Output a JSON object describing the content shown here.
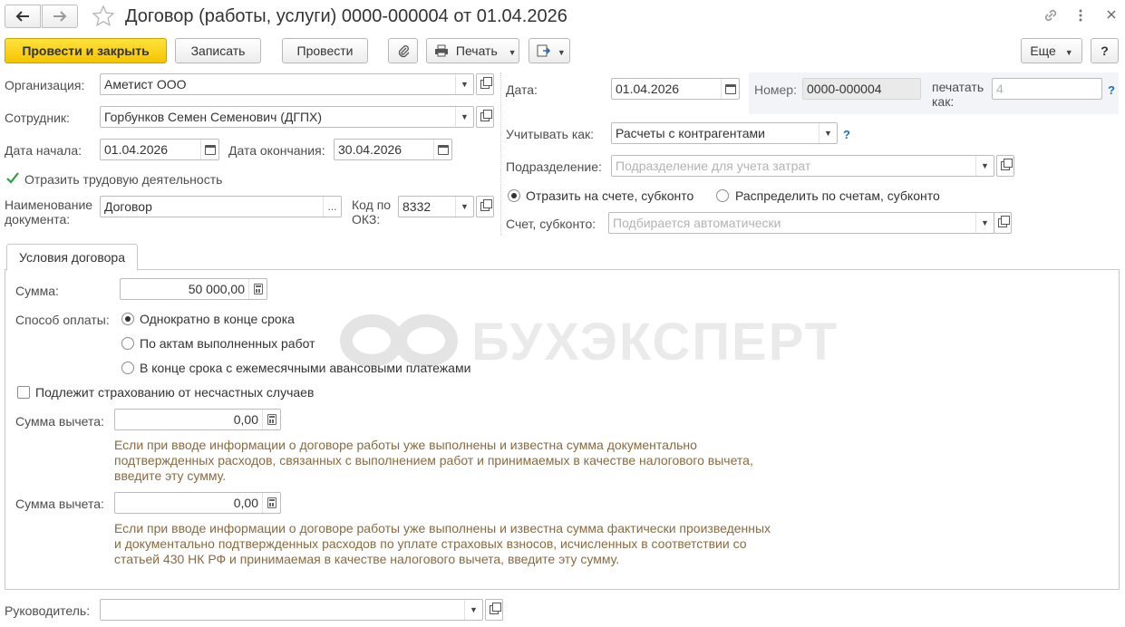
{
  "window": {
    "title": "Договор (работы, услуги) 0000-000004 от 01.04.2026"
  },
  "toolbar": {
    "post_close": "Провести и закрыть",
    "save": "Записать",
    "post": "Провести",
    "print": "Печать",
    "more": "Еще",
    "help": "?"
  },
  "left": {
    "org_label": "Организация:",
    "org_value": "Аметист ООО",
    "employee_label": "Сотрудник:",
    "employee_value": "Горбунков Семен Семенович (ДГПХ)",
    "start_label": "Дата начала:",
    "start_value": "01.04.2026",
    "end_label": "Дата окончания:",
    "end_value": "30.04.2026",
    "labor_check_label": "Отразить трудовую деятельность",
    "docname_label_1": "Наименование",
    "docname_label_2": "документа:",
    "docname_value": "Договор",
    "okz_label_1": "Код по",
    "okz_label_2": "ОКЗ:",
    "okz_value": "8332"
  },
  "right": {
    "date_label": "Дата:",
    "date_value": "01.04.2026",
    "number_label": "Номер:",
    "number_value": "0000-000004",
    "print_as_label_1": "печатать",
    "print_as_label_2": "как:",
    "print_as_placeholder": "4",
    "account_as_label": "Учитывать как:",
    "account_as_value": "Расчеты с контрагентами",
    "dept_label": "Подразделение:",
    "dept_placeholder": "Подразделение для учета затрат",
    "radio_account": "Отразить на счете, субконто",
    "radio_distribute": "Распределить по счетам, субконто",
    "subconto_label": "Счет, субконто:",
    "subconto_placeholder": "Подбирается автоматически",
    "help_mark": "?"
  },
  "tab": {
    "label": "Условия договора",
    "sum_label": "Сумма:",
    "sum_value": "50 000,00",
    "payment_label": "Способ оплаты:",
    "payment_options": [
      "Однократно в конце срока",
      "По актам выполненных работ",
      "В конце срока с ежемесячными авансовыми платежами"
    ],
    "insurance_label": "Подлежит страхованию от несчастных случаев",
    "deduction1_label": "Сумма вычета:",
    "deduction1_value": "0,00",
    "hint1": [
      "Если при вводе информации о договоре работы уже выполнены и известна сумма документально",
      "подтвержденных расходов, связанных с выполнением работ и принимаемых в качестве налогового вычета,",
      "введите эту сумму."
    ],
    "deduction2_label": "Сумма вычета:",
    "deduction2_value": "0,00",
    "hint2": [
      "Если при вводе информации о договоре работы уже выполнены и известна сумма фактически произведенных",
      "и документально подтвержденных расходов по уплате страховых взносов, исчисленных в соответствии со",
      "статьей 430 НК РФ и принимаемая в качестве налогового вычета, введите эту сумму."
    ]
  },
  "footer": {
    "manager_label": "Руководитель:",
    "manager_value": ""
  },
  "watermark": {
    "text": "БУХЭКСПЕРТ"
  },
  "colors": {
    "primary_button": "#f5c400",
    "hint_text": "#8a6a3f",
    "help_link": "#1a6fc7"
  }
}
